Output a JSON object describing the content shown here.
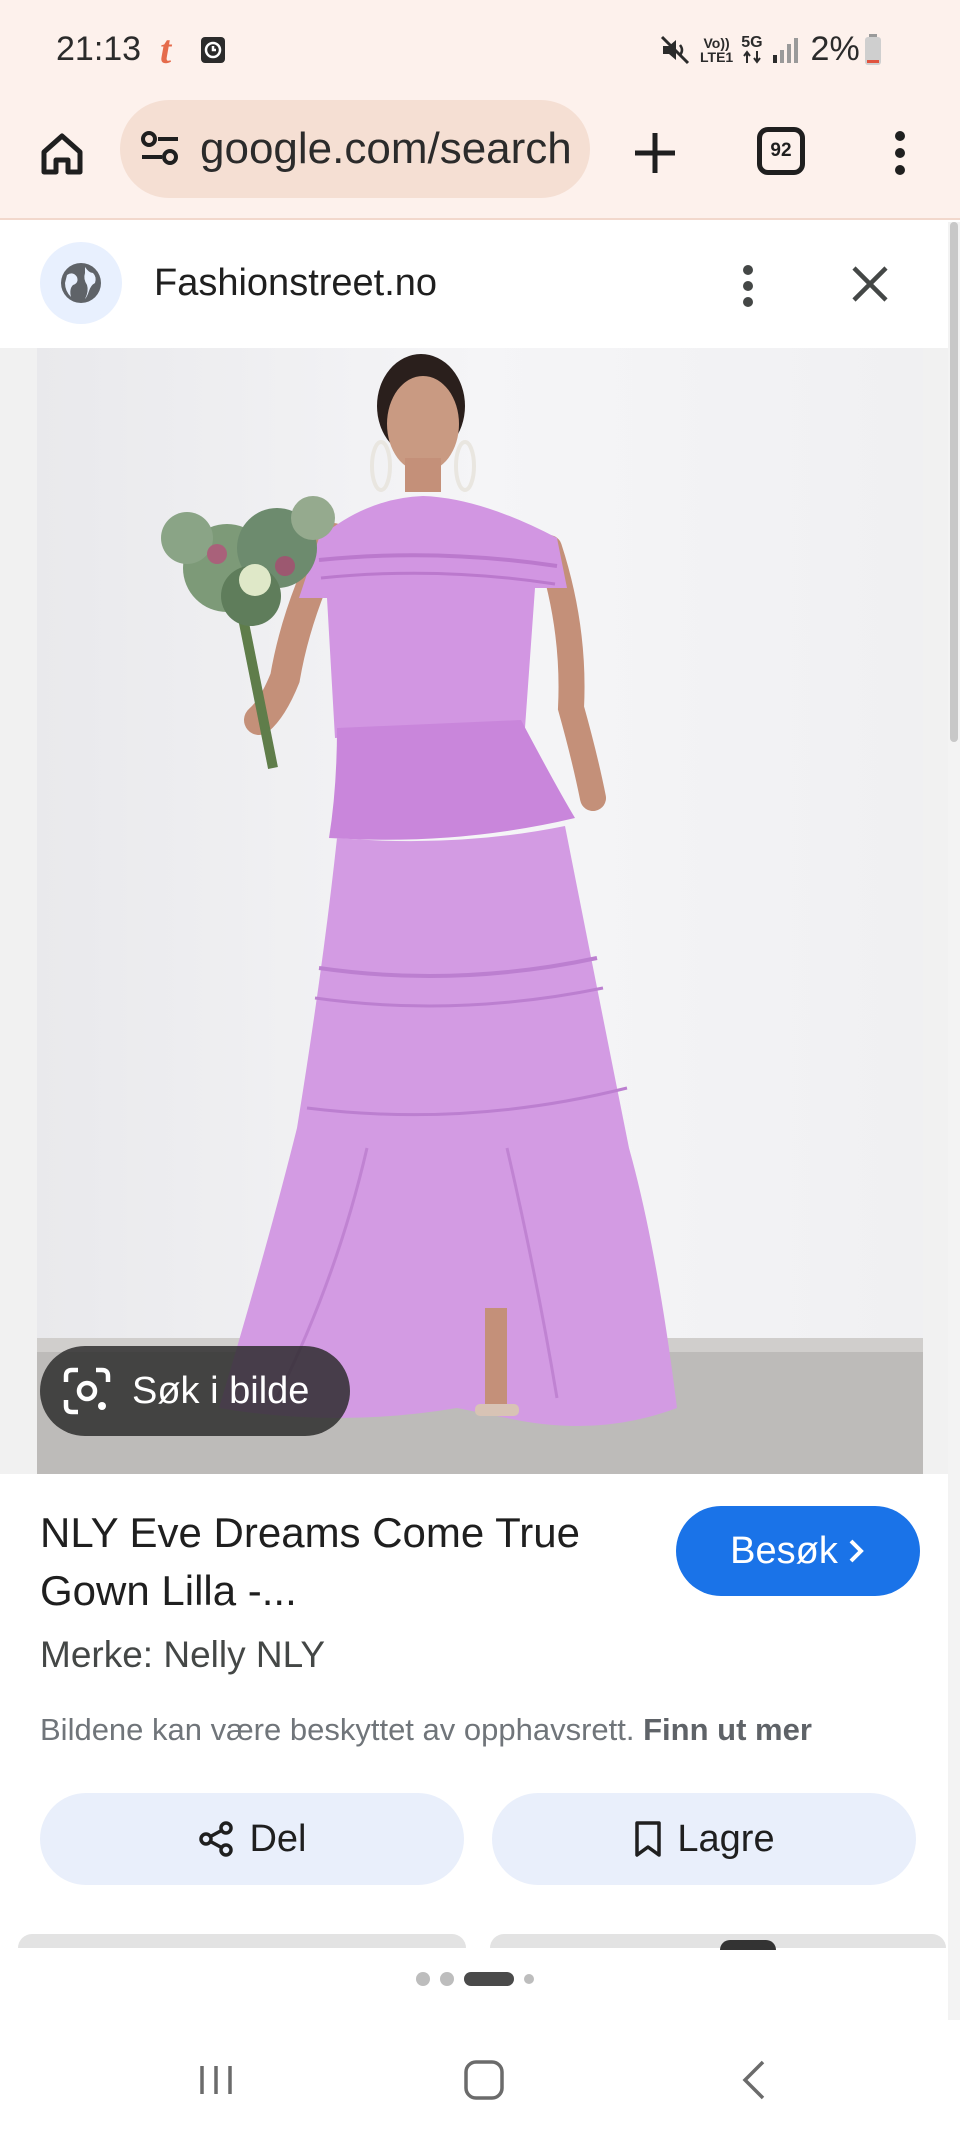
{
  "status_bar": {
    "time": "21:13",
    "app_glyph": "t",
    "network_top": "Vo))",
    "network_bottom": "LTE1",
    "network_5g": "5G",
    "battery": "2%",
    "icons": [
      "mute-icon",
      "clock-notification-icon",
      "signal-icon",
      "battery-icon"
    ]
  },
  "browser": {
    "url": "google.com/search",
    "tab_count": "92",
    "icons": [
      "home-icon",
      "site-settings-icon",
      "plus-icon",
      "tabs-icon",
      "more-vert-icon"
    ]
  },
  "panel": {
    "site_name": "Fashionstreet.no",
    "icons": [
      "globe-icon",
      "more-vert-icon",
      "close-icon"
    ]
  },
  "image": {
    "lens_label": "Søk i bilde",
    "dress_color": "#cf8ee0"
  },
  "result": {
    "title": "NLY Eve Dreams Come True Gown Lilla -...",
    "visit_label": "Besøk",
    "brand": "Merke: Nelly NLY",
    "copyright_text": "Bildene kan være beskyttet av opphavsrett.",
    "learn_more": "Finn ut mer",
    "share_label": "Del",
    "save_label": "Lagre"
  },
  "colors": {
    "accent": "#1a73e8",
    "chrome_bg": "#fdf1ec",
    "url_pill": "#f5dfd3",
    "action_bg": "#e9effb"
  },
  "nav": {
    "icons": [
      "recent-apps-icon",
      "home-circle-icon",
      "back-icon"
    ]
  }
}
